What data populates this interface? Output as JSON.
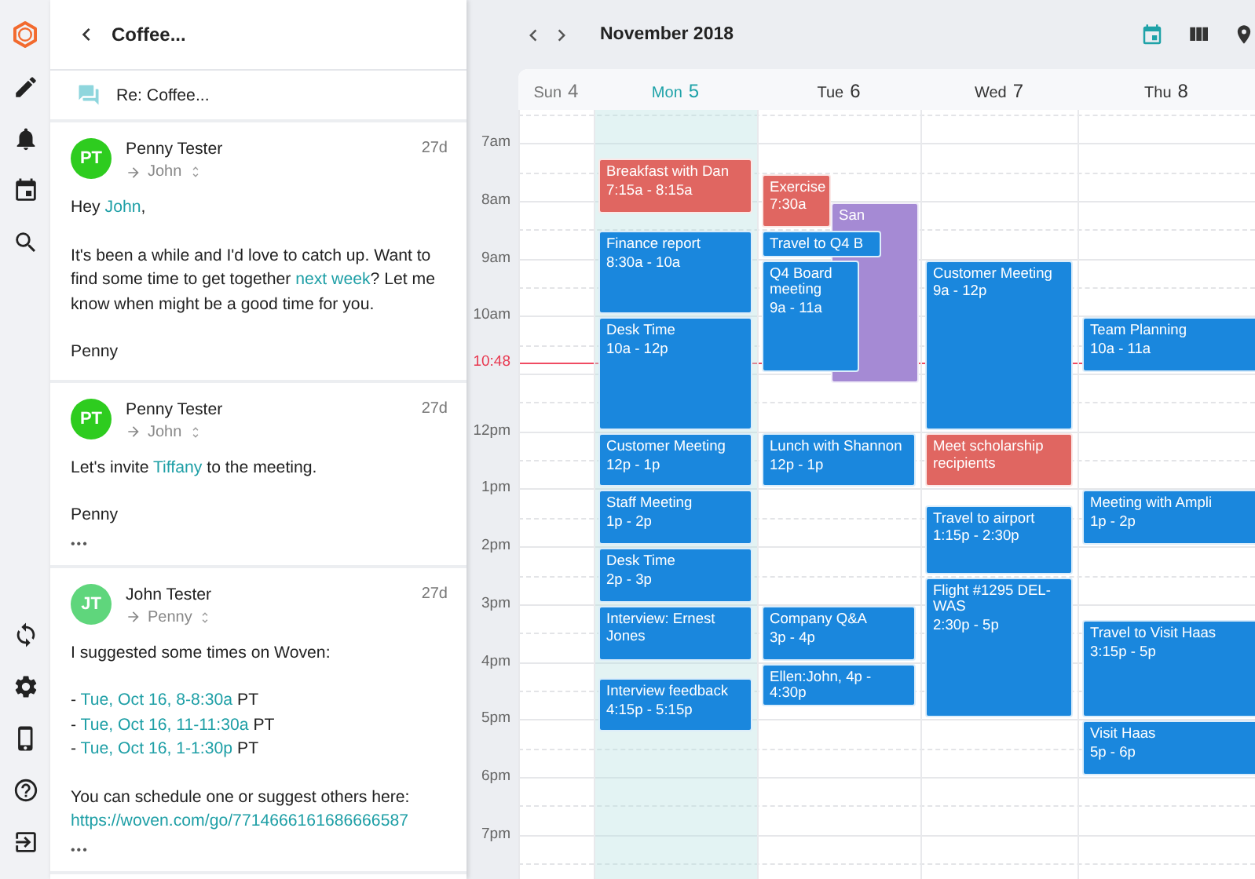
{
  "thread": {
    "title": "Coffee...",
    "subject": "Re: Coffee...",
    "messages": [
      {
        "initials": "PT",
        "color": "#2ecc1f",
        "sender": "Penny Tester",
        "recipient": "John",
        "age": "27d",
        "blocks": [
          [
            [
              {
                "text": "Hey "
              },
              {
                "text": "John",
                "kind": "link"
              },
              {
                "text": ","
              }
            ]
          ],
          [
            [
              {
                "text": "It's been a while and I'd love to catch up. Want to find some time to get together "
              },
              {
                "text": "next week",
                "kind": "link"
              },
              {
                "text": "? Let me know when might be a good time for you."
              }
            ]
          ],
          [
            [
              {
                "text": "Penny"
              }
            ]
          ]
        ]
      },
      {
        "initials": "PT",
        "color": "#2ecc1f",
        "sender": "Penny Tester",
        "recipient": "John",
        "age": "27d",
        "blocks": [
          [
            [
              {
                "text": "Let's invite "
              },
              {
                "text": "Tiffany",
                "kind": "link"
              },
              {
                "text": " to the meeting."
              }
            ]
          ],
          [
            [
              {
                "text": "Penny"
              }
            ]
          ]
        ],
        "more": "•••"
      },
      {
        "initials": "JT",
        "color": "#5fd67c",
        "sender": "John Tester",
        "recipient": "Penny",
        "age": "27d",
        "blocks": [
          [
            [
              {
                "text": "I suggested some times on Woven:"
              }
            ]
          ],
          [
            [
              {
                "text": "- "
              },
              {
                "text": "Tue, Oct 16, 8-8:30a",
                "kind": "link"
              },
              {
                "text": " PT"
              }
            ],
            [
              {
                "text": "- "
              },
              {
                "text": "Tue, Oct 16, 11-11:30a",
                "kind": "link"
              },
              {
                "text": " PT"
              }
            ],
            [
              {
                "text": "- "
              },
              {
                "text": "Tue, Oct 16, 1-1:30p",
                "kind": "link"
              },
              {
                "text": " PT"
              }
            ]
          ],
          [
            [
              {
                "text": "You can schedule one or suggest others here:"
              }
            ],
            [
              {
                "text": "https://woven.com/go/7714666161686666587",
                "kind": "link"
              }
            ]
          ]
        ],
        "more": "•••"
      }
    ]
  },
  "calendar": {
    "month": "November 2018",
    "now": "10:48",
    "time_labels": [
      "7am",
      "8am",
      "9am",
      "10am",
      "12pm",
      "1pm",
      "2pm",
      "3pm",
      "4pm",
      "5pm",
      "6pm",
      "7pm"
    ],
    "days": [
      {
        "name": "Sun",
        "number": "4",
        "selected": false,
        "past": true
      },
      {
        "name": "Mon",
        "number": "5",
        "selected": true,
        "past": false,
        "events": [
          {
            "title": "Breakfast with Dan",
            "time": "7:15a - 8:15a",
            "color": "#e06661"
          },
          {
            "title": "Finance report",
            "time": "8:30a - 10a",
            "color": "#1a87dd"
          },
          {
            "title": "Desk Time",
            "time": "10a - 12p",
            "color": "#1a87dd"
          },
          {
            "title": "Customer Meeting",
            "time": "12p - 1p",
            "color": "#1a87dd"
          },
          {
            "title": "Staff Meeting",
            "time": "1p - 2p",
            "color": "#1a87dd"
          },
          {
            "title": "Desk Time",
            "time": "2p - 3p",
            "color": "#1a87dd"
          },
          {
            "title": "Interview: Ernest Jones",
            "color": "#1a87dd"
          },
          {
            "title": "Interview feedback",
            "time": "4:15p - 5:15p",
            "color": "#1a87dd"
          }
        ]
      },
      {
        "name": "Tue",
        "number": "6",
        "selected": false,
        "past": false,
        "events": [
          {
            "title": "Exercise",
            "time": "7:30a",
            "color": "#e06661"
          },
          {
            "title": "San",
            "color": "#a58ad4"
          },
          {
            "title": "Travel to Q4 B",
            "color": "#1a87dd"
          },
          {
            "title": "Q4 Board meeting",
            "time": "9a - 11a",
            "color": "#1a87dd"
          },
          {
            "title": "Lunch with Shannon",
            "time": "12p - 1p",
            "color": "#1a87dd"
          },
          {
            "title": "Company Q&A",
            "time": "3p - 4p",
            "color": "#1a87dd"
          },
          {
            "title": "Ellen:John, 4p - 4:30p",
            "color": "#1a87dd"
          }
        ]
      },
      {
        "name": "Wed",
        "number": "7",
        "selected": false,
        "past": false,
        "events": [
          {
            "title": "Customer Meeting",
            "time": "9a - 12p",
            "color": "#1a87dd"
          },
          {
            "title": "Meet scholarship recipients",
            "color": "#e06661"
          },
          {
            "title": "Travel to airport",
            "time": "1:15p - 2:30p",
            "color": "#1a87dd"
          },
          {
            "title": "Flight #1295 DEL-WAS",
            "time": "2:30p - 5p",
            "color": "#1a87dd"
          }
        ]
      },
      {
        "name": "Thu",
        "number": "8",
        "selected": false,
        "past": false,
        "events": [
          {
            "title": "Team Planning",
            "time": "10a - 11a",
            "color": "#1a87dd"
          },
          {
            "title": "Meeting with Ampli",
            "time": "1p - 2p",
            "color": "#1a87dd"
          },
          {
            "title": "Travel to Visit Haas",
            "time": "3:15p - 5p",
            "color": "#1a87dd"
          },
          {
            "title": "Visit Haas",
            "time": "5p - 6p",
            "color": "#1a87dd"
          }
        ]
      }
    ]
  }
}
